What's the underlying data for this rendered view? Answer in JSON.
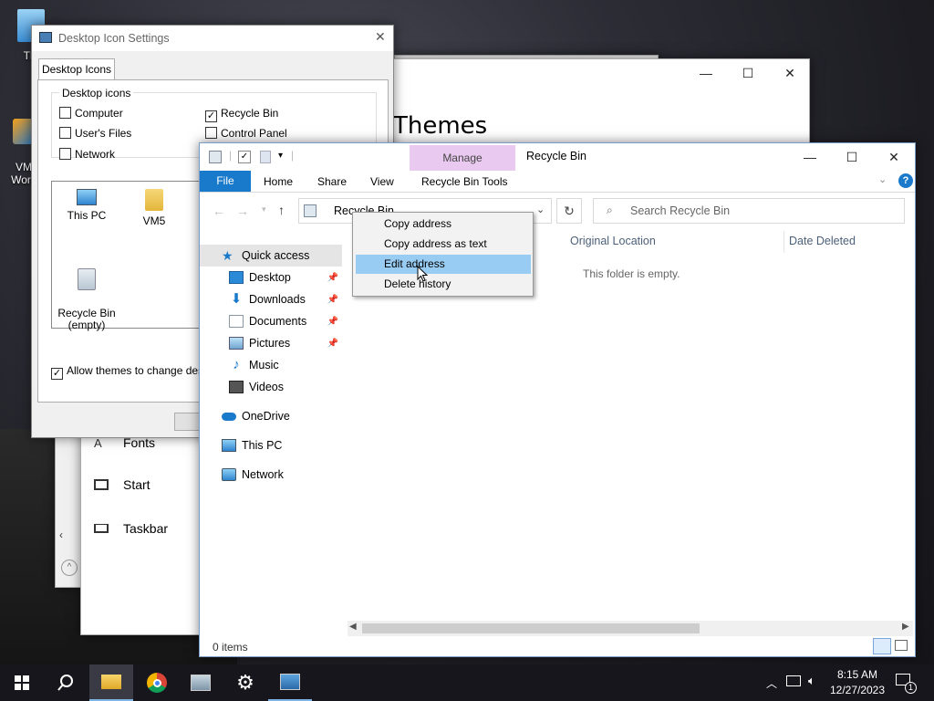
{
  "desktop": {
    "icons": [
      {
        "label": "Thi"
      },
      {
        "label": "VM\nWork"
      }
    ]
  },
  "settings_window": {
    "heading": "Themes",
    "items": [
      {
        "label": "Fonts",
        "icon": "font-icon"
      },
      {
        "label": "Start",
        "icon": "start-icon"
      },
      {
        "label": "Taskbar",
        "icon": "taskbar-icon"
      }
    ]
  },
  "dialog": {
    "title": "Desktop Icon Settings",
    "tab": "Desktop Icons",
    "group_label": "Desktop icons",
    "checkboxes": [
      {
        "label": "Computer",
        "checked": false
      },
      {
        "label": "Recycle Bin",
        "checked": true
      },
      {
        "label": "User's Files",
        "checked": false
      },
      {
        "label": "Control Panel",
        "checked": false
      },
      {
        "label": "Network",
        "checked": false
      }
    ],
    "preview_icons": [
      {
        "label": "This PC"
      },
      {
        "label": "VM5"
      },
      {
        "label": "Recycle Bin\n(empty)"
      }
    ],
    "allow_themes_label": "Allow themes to change deskto",
    "allow_themes_checked": true
  },
  "explorer": {
    "title": "Recycle Bin",
    "contextual_tab_group": "Manage",
    "ribbon_tabs": [
      "File",
      "Home",
      "Share",
      "View",
      "Recycle Bin Tools"
    ],
    "address": "Recycle Bin",
    "search_placeholder": "Search Recycle Bin",
    "nav": {
      "quick_access": "Quick access",
      "items": [
        {
          "label": "Desktop",
          "pinned": true
        },
        {
          "label": "Downloads",
          "pinned": true
        },
        {
          "label": "Documents",
          "pinned": true
        },
        {
          "label": "Pictures",
          "pinned": true
        },
        {
          "label": "Music",
          "pinned": false
        },
        {
          "label": "Videos",
          "pinned": false
        }
      ],
      "onedrive": "OneDrive",
      "this_pc": "This PC",
      "network": "Network"
    },
    "columns": [
      "Original Location",
      "Date Deleted"
    ],
    "empty_message": "This folder is empty.",
    "status": "0 items"
  },
  "context_menu": {
    "items": [
      {
        "label": "Copy address",
        "selected": false
      },
      {
        "label": "Copy address as text",
        "selected": false
      },
      {
        "label": "Edit address",
        "selected": true
      },
      {
        "label": "Delete history",
        "selected": false
      }
    ]
  },
  "taskbar": {
    "time": "8:15 AM",
    "date": "12/27/2023",
    "notification_count": "1"
  },
  "colors": {
    "accent": "#0063b1",
    "manage_tab": "#e9c9f0",
    "menu_highlight": "#99ccf3"
  }
}
